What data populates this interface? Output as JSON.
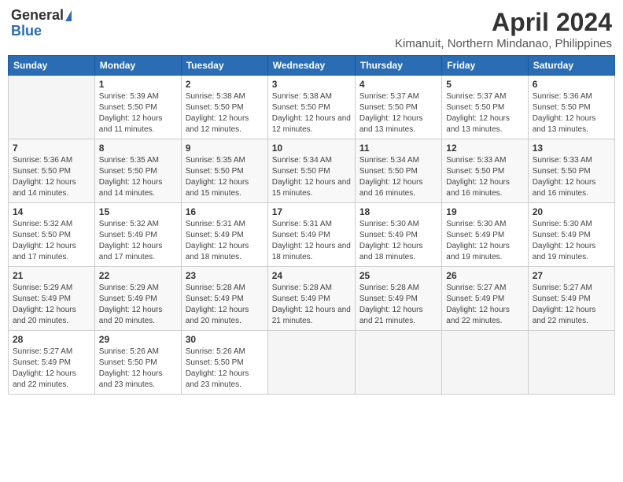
{
  "header": {
    "logo_general": "General",
    "logo_blue": "Blue",
    "title": "April 2024",
    "subtitle": "Kimanuit, Northern Mindanao, Philippines"
  },
  "days_of_week": [
    "Sunday",
    "Monday",
    "Tuesday",
    "Wednesday",
    "Thursday",
    "Friday",
    "Saturday"
  ],
  "weeks": [
    [
      {
        "day": "",
        "sunrise": "",
        "sunset": "",
        "daylight": ""
      },
      {
        "day": "1",
        "sunrise": "Sunrise: 5:39 AM",
        "sunset": "Sunset: 5:50 PM",
        "daylight": "Daylight: 12 hours and 11 minutes."
      },
      {
        "day": "2",
        "sunrise": "Sunrise: 5:38 AM",
        "sunset": "Sunset: 5:50 PM",
        "daylight": "Daylight: 12 hours and 12 minutes."
      },
      {
        "day": "3",
        "sunrise": "Sunrise: 5:38 AM",
        "sunset": "Sunset: 5:50 PM",
        "daylight": "Daylight: 12 hours and 12 minutes."
      },
      {
        "day": "4",
        "sunrise": "Sunrise: 5:37 AM",
        "sunset": "Sunset: 5:50 PM",
        "daylight": "Daylight: 12 hours and 13 minutes."
      },
      {
        "day": "5",
        "sunrise": "Sunrise: 5:37 AM",
        "sunset": "Sunset: 5:50 PM",
        "daylight": "Daylight: 12 hours and 13 minutes."
      },
      {
        "day": "6",
        "sunrise": "Sunrise: 5:36 AM",
        "sunset": "Sunset: 5:50 PM",
        "daylight": "Daylight: 12 hours and 13 minutes."
      }
    ],
    [
      {
        "day": "7",
        "sunrise": "Sunrise: 5:36 AM",
        "sunset": "Sunset: 5:50 PM",
        "daylight": "Daylight: 12 hours and 14 minutes."
      },
      {
        "day": "8",
        "sunrise": "Sunrise: 5:35 AM",
        "sunset": "Sunset: 5:50 PM",
        "daylight": "Daylight: 12 hours and 14 minutes."
      },
      {
        "day": "9",
        "sunrise": "Sunrise: 5:35 AM",
        "sunset": "Sunset: 5:50 PM",
        "daylight": "Daylight: 12 hours and 15 minutes."
      },
      {
        "day": "10",
        "sunrise": "Sunrise: 5:34 AM",
        "sunset": "Sunset: 5:50 PM",
        "daylight": "Daylight: 12 hours and 15 minutes."
      },
      {
        "day": "11",
        "sunrise": "Sunrise: 5:34 AM",
        "sunset": "Sunset: 5:50 PM",
        "daylight": "Daylight: 12 hours and 16 minutes."
      },
      {
        "day": "12",
        "sunrise": "Sunrise: 5:33 AM",
        "sunset": "Sunset: 5:50 PM",
        "daylight": "Daylight: 12 hours and 16 minutes."
      },
      {
        "day": "13",
        "sunrise": "Sunrise: 5:33 AM",
        "sunset": "Sunset: 5:50 PM",
        "daylight": "Daylight: 12 hours and 16 minutes."
      }
    ],
    [
      {
        "day": "14",
        "sunrise": "Sunrise: 5:32 AM",
        "sunset": "Sunset: 5:50 PM",
        "daylight": "Daylight: 12 hours and 17 minutes."
      },
      {
        "day": "15",
        "sunrise": "Sunrise: 5:32 AM",
        "sunset": "Sunset: 5:49 PM",
        "daylight": "Daylight: 12 hours and 17 minutes."
      },
      {
        "day": "16",
        "sunrise": "Sunrise: 5:31 AM",
        "sunset": "Sunset: 5:49 PM",
        "daylight": "Daylight: 12 hours and 18 minutes."
      },
      {
        "day": "17",
        "sunrise": "Sunrise: 5:31 AM",
        "sunset": "Sunset: 5:49 PM",
        "daylight": "Daylight: 12 hours and 18 minutes."
      },
      {
        "day": "18",
        "sunrise": "Sunrise: 5:30 AM",
        "sunset": "Sunset: 5:49 PM",
        "daylight": "Daylight: 12 hours and 18 minutes."
      },
      {
        "day": "19",
        "sunrise": "Sunrise: 5:30 AM",
        "sunset": "Sunset: 5:49 PM",
        "daylight": "Daylight: 12 hours and 19 minutes."
      },
      {
        "day": "20",
        "sunrise": "Sunrise: 5:30 AM",
        "sunset": "Sunset: 5:49 PM",
        "daylight": "Daylight: 12 hours and 19 minutes."
      }
    ],
    [
      {
        "day": "21",
        "sunrise": "Sunrise: 5:29 AM",
        "sunset": "Sunset: 5:49 PM",
        "daylight": "Daylight: 12 hours and 20 minutes."
      },
      {
        "day": "22",
        "sunrise": "Sunrise: 5:29 AM",
        "sunset": "Sunset: 5:49 PM",
        "daylight": "Daylight: 12 hours and 20 minutes."
      },
      {
        "day": "23",
        "sunrise": "Sunrise: 5:28 AM",
        "sunset": "Sunset: 5:49 PM",
        "daylight": "Daylight: 12 hours and 20 minutes."
      },
      {
        "day": "24",
        "sunrise": "Sunrise: 5:28 AM",
        "sunset": "Sunset: 5:49 PM",
        "daylight": "Daylight: 12 hours and 21 minutes."
      },
      {
        "day": "25",
        "sunrise": "Sunrise: 5:28 AM",
        "sunset": "Sunset: 5:49 PM",
        "daylight": "Daylight: 12 hours and 21 minutes."
      },
      {
        "day": "26",
        "sunrise": "Sunrise: 5:27 AM",
        "sunset": "Sunset: 5:49 PM",
        "daylight": "Daylight: 12 hours and 22 minutes."
      },
      {
        "day": "27",
        "sunrise": "Sunrise: 5:27 AM",
        "sunset": "Sunset: 5:49 PM",
        "daylight": "Daylight: 12 hours and 22 minutes."
      }
    ],
    [
      {
        "day": "28",
        "sunrise": "Sunrise: 5:27 AM",
        "sunset": "Sunset: 5:49 PM",
        "daylight": "Daylight: 12 hours and 22 minutes."
      },
      {
        "day": "29",
        "sunrise": "Sunrise: 5:26 AM",
        "sunset": "Sunset: 5:50 PM",
        "daylight": "Daylight: 12 hours and 23 minutes."
      },
      {
        "day": "30",
        "sunrise": "Sunrise: 5:26 AM",
        "sunset": "Sunset: 5:50 PM",
        "daylight": "Daylight: 12 hours and 23 minutes."
      },
      {
        "day": "",
        "sunrise": "",
        "sunset": "",
        "daylight": ""
      },
      {
        "day": "",
        "sunrise": "",
        "sunset": "",
        "daylight": ""
      },
      {
        "day": "",
        "sunrise": "",
        "sunset": "",
        "daylight": ""
      },
      {
        "day": "",
        "sunrise": "",
        "sunset": "",
        "daylight": ""
      }
    ]
  ]
}
